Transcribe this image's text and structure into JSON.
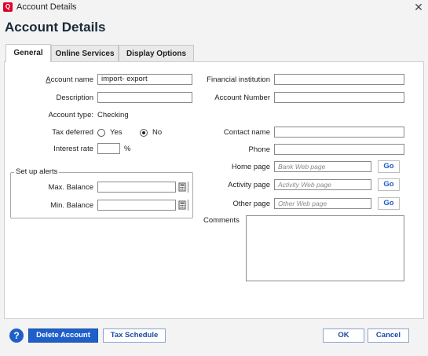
{
  "window": {
    "title": "Account Details",
    "app_icon_letter": "Q",
    "close_glyph": "✕"
  },
  "heading": "Account Details",
  "tabs": [
    "General",
    "Online Services",
    "Display Options"
  ],
  "form": {
    "account_name_label": "Account name",
    "account_name_value": "import- export",
    "description_label": "Description",
    "description_value": "",
    "account_type_label": "Account type:",
    "account_type_value": "Checking",
    "tax_deferred_label": "Tax deferred",
    "tax_yes": "Yes",
    "tax_no": "No",
    "tax_deferred_selected": "No",
    "interest_rate_label": "Interest rate",
    "interest_rate_value": "",
    "percent_sign": "%",
    "financial_institution_label": "Financial institution",
    "financial_institution_value": "",
    "account_number_label": "Account Number",
    "account_number_value": "",
    "contact_name_label": "Contact name",
    "contact_name_value": "",
    "phone_label": "Phone",
    "phone_value": "",
    "home_page_label": "Home page",
    "home_page_placeholder": "Bank Web page",
    "activity_page_label": "Activity page",
    "activity_page_placeholder": "Activity Web page",
    "other_page_label": "Other page",
    "other_page_placeholder": "Other Web page",
    "go_label": "Go",
    "comments_label": "Comments",
    "comments_value": ""
  },
  "alerts": {
    "group_title": "Set up alerts",
    "max_balance_label": "Max. Balance",
    "max_balance_value": "",
    "min_balance_label": "Min. Balance",
    "min_balance_value": ""
  },
  "footer": {
    "help_glyph": "?",
    "delete_account": "Delete Account",
    "tax_schedule": "Tax Schedule",
    "ok": "OK",
    "cancel": "Cancel"
  },
  "colors": {
    "accent": "#1f5fc9",
    "app_icon": "#e0002a",
    "link": "#1b58c7"
  },
  "icons": [
    "app-icon",
    "close-icon",
    "calculator-icon",
    "help-icon"
  ]
}
